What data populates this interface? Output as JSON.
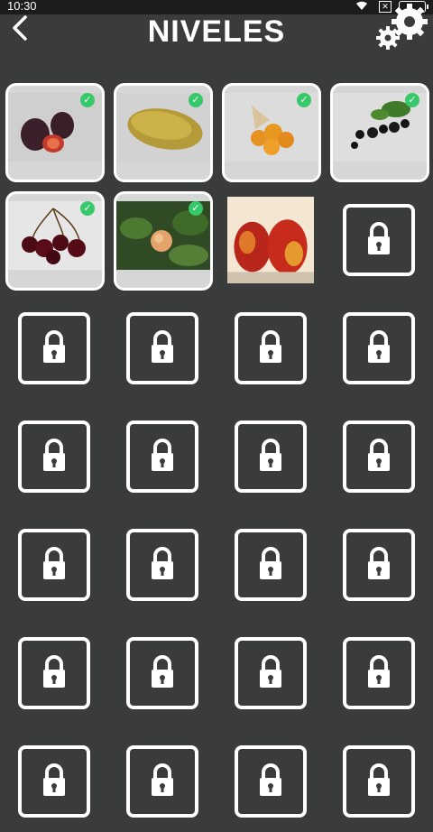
{
  "status": {
    "time": "10:30",
    "sim": "✕"
  },
  "header": {
    "title": "NIVELES"
  },
  "levels": [
    {
      "state": "completed",
      "fruit": "fig-icon"
    },
    {
      "state": "completed",
      "fruit": "papaya-icon"
    },
    {
      "state": "completed",
      "fruit": "physalis-icon"
    },
    {
      "state": "completed",
      "fruit": "blackcurrant-icon"
    },
    {
      "state": "completed",
      "fruit": "cherry-icon"
    },
    {
      "state": "completed",
      "fruit": "cloudberry-icon"
    },
    {
      "state": "current",
      "fruit": "nectarine-icon"
    },
    {
      "state": "locked"
    },
    {
      "state": "locked"
    },
    {
      "state": "locked"
    },
    {
      "state": "locked"
    },
    {
      "state": "locked"
    },
    {
      "state": "locked"
    },
    {
      "state": "locked"
    },
    {
      "state": "locked"
    },
    {
      "state": "locked"
    },
    {
      "state": "locked"
    },
    {
      "state": "locked"
    },
    {
      "state": "locked"
    },
    {
      "state": "locked"
    },
    {
      "state": "locked"
    },
    {
      "state": "locked"
    },
    {
      "state": "locked"
    },
    {
      "state": "locked"
    },
    {
      "state": "locked"
    },
    {
      "state": "locked"
    },
    {
      "state": "locked"
    },
    {
      "state": "locked"
    }
  ],
  "colors": {
    "background": "#3a3c3c",
    "check": "#35c96a"
  }
}
